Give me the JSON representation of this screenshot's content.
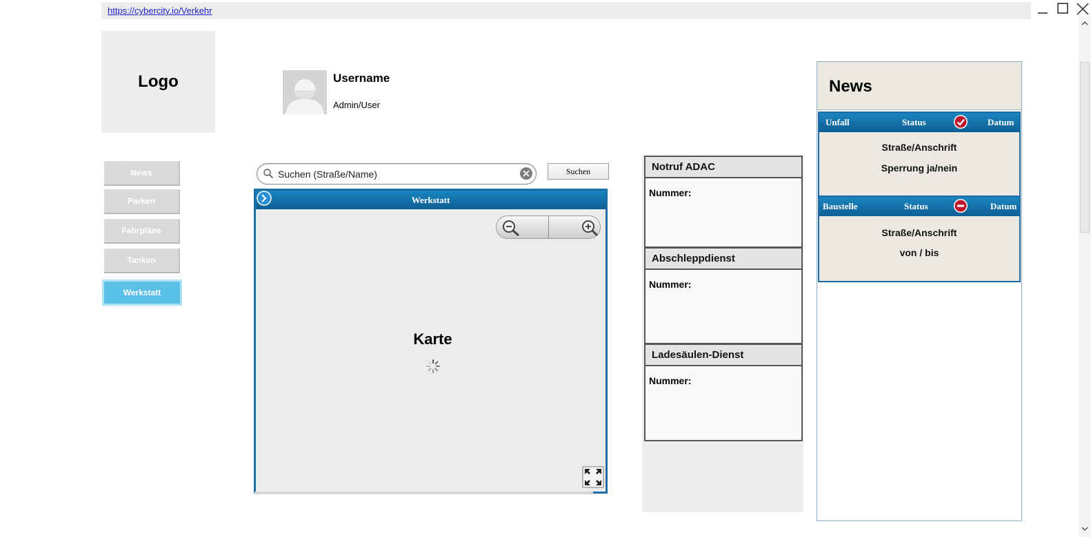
{
  "browser": {
    "url": "https://cybercity.io/Verkehr"
  },
  "logo": {
    "label": "Logo"
  },
  "user": {
    "name": "Username",
    "role": "Admin/User"
  },
  "nav": {
    "items": [
      {
        "label": "News",
        "active": false
      },
      {
        "label": "Parken",
        "active": false
      },
      {
        "label": "Fahrpläne",
        "active": false
      },
      {
        "label": "Tanken",
        "active": false
      },
      {
        "label": "Werkstatt",
        "active": true
      }
    ]
  },
  "search": {
    "placeholder": "Suchen (Straße/Name)",
    "button_label": "Suchen"
  },
  "map": {
    "header": "Werkstatt",
    "title": "Karte"
  },
  "emergency": [
    {
      "title": "Notruf ADAC",
      "label": "Nummer:"
    },
    {
      "title": "Abschleppdienst",
      "label": "Nummer:"
    },
    {
      "title": "Ladesäulen-Dienst",
      "label": "Nummer:"
    }
  ],
  "news": {
    "title": "News",
    "cards": [
      {
        "type": "Unfall",
        "status_label": "Status",
        "status_icon": "check-circle-icon",
        "status_color": "#c0182a",
        "date_label": "Datum",
        "lines": [
          "Straße/Anschrift",
          "Sperrung ja/nein"
        ]
      },
      {
        "type": "Baustelle",
        "status_label": "Status",
        "status_icon": "minus-circle-icon",
        "status_color": "#c0182a",
        "date_label": "Datum",
        "lines": [
          "Straße/Anschrift",
          "von / bis"
        ]
      }
    ]
  },
  "colors": {
    "accent_blue": "#1a78b4",
    "nav_active": "#5bc0e8",
    "nav_inactive": "#d9d9d9"
  }
}
